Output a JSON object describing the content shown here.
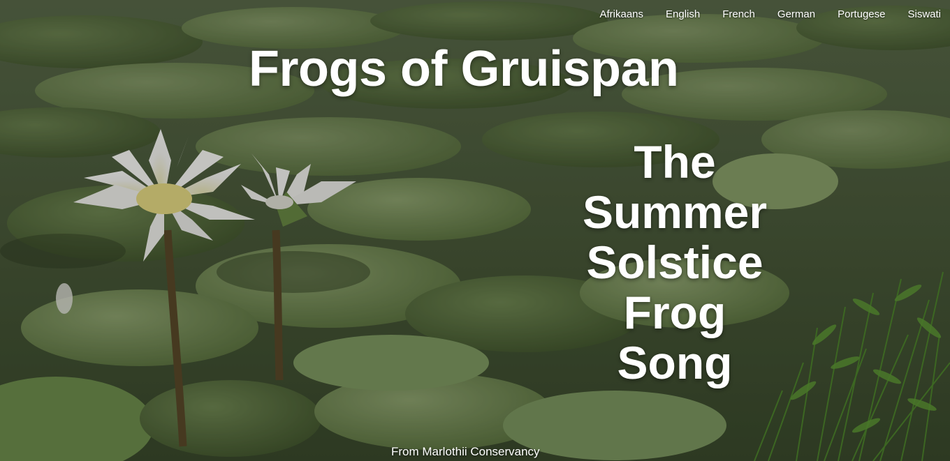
{
  "nav": {
    "languages": [
      "Afrikaans",
      "English",
      "French",
      "German",
      "Portugese",
      "Siswati"
    ]
  },
  "hero": {
    "title": "Frogs of Gruispan",
    "subtitle_lines": [
      "The",
      "Summer",
      "Solstice",
      "Frog",
      "Song"
    ],
    "credit": "From Marlothii Conservancy"
  },
  "colors": {
    "text": "#ffffff",
    "pond_dark": "#3e4a2c",
    "lily_pad": "#6f8a4e",
    "lily_pad_light": "#93a878",
    "grass": "#4e7a2f",
    "flower": "#f4f4ef",
    "flower_center": "#e8de8a"
  }
}
